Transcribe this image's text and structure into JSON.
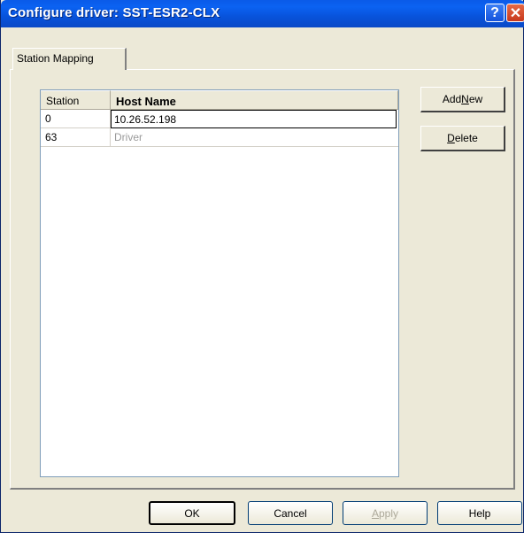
{
  "window": {
    "title": "Configure driver: SST-ESR2-CLX",
    "help_glyph": "?",
    "close_glyph": "✕"
  },
  "tabs": [
    {
      "label": "Station Mapping",
      "selected": true
    }
  ],
  "list": {
    "columns": [
      "Station",
      "Host Name"
    ],
    "rows": [
      {
        "station": "0",
        "host": "10.26.52.198",
        "editing": true
      },
      {
        "station": "63",
        "host": "Driver",
        "editing": false
      }
    ]
  },
  "side_buttons": {
    "add_new": {
      "prefix": "Add ",
      "mnemonic": "N",
      "suffix": "ew"
    },
    "delete": {
      "prefix": "",
      "mnemonic": "D",
      "suffix": "elete"
    }
  },
  "footer_buttons": {
    "ok": "OK",
    "cancel": "Cancel",
    "apply": {
      "prefix": "",
      "mnemonic": "A",
      "suffix": "pply",
      "disabled": true
    },
    "help": "Help"
  }
}
